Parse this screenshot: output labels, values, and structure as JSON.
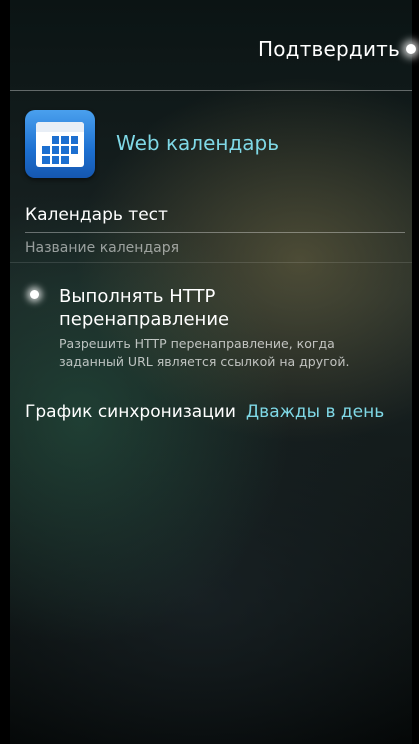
{
  "header": {
    "confirm_label": "Подтвердить"
  },
  "app": {
    "name": "Web календарь",
    "icon": "calendar-icon",
    "accent": "#7fd8e6"
  },
  "calendar": {
    "name_value": "Календарь тест",
    "name_hint": "Название календаря"
  },
  "redirect_option": {
    "title": "Выполнять HTTP перенаправление",
    "description": "Разрешить HTTP перенаправление, когда заданный URL является ссылкой на другой.",
    "checked": true
  },
  "sync": {
    "label": "График синхронизации",
    "value": "Дважды в день"
  }
}
